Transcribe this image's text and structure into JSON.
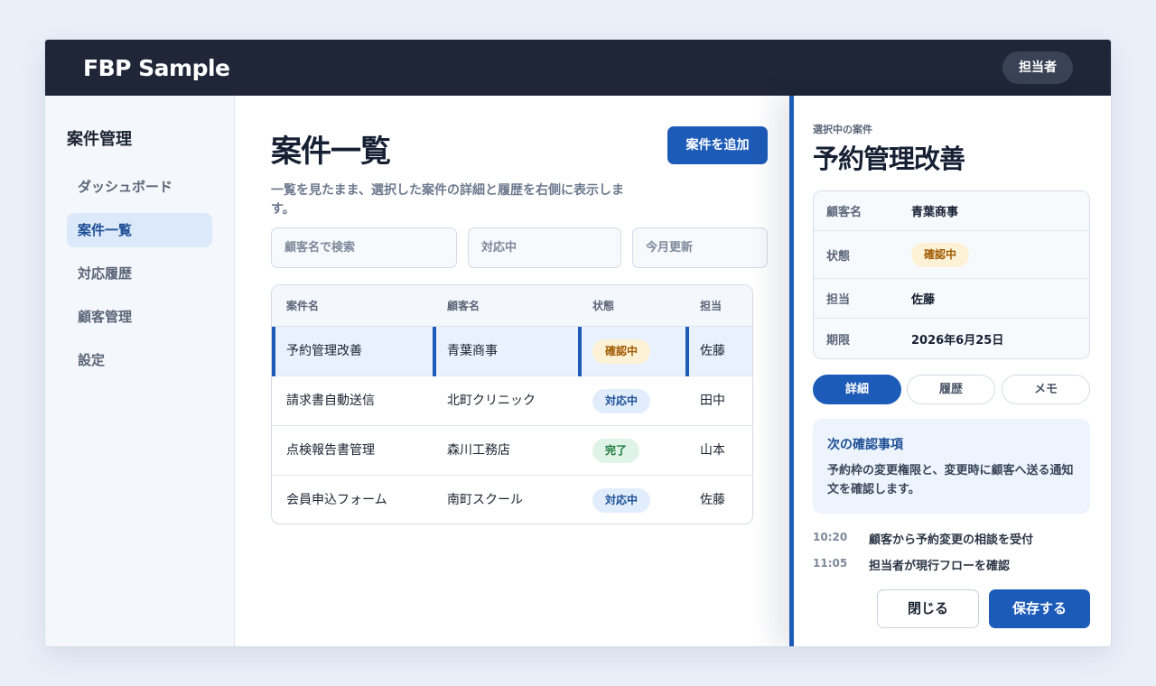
{
  "app": {
    "brand": "FBP Sample",
    "user": "担当者"
  },
  "sidebar": {
    "title": "案件管理",
    "items": [
      {
        "label": "ダッシュボード",
        "active": false
      },
      {
        "label": "案件一覧",
        "active": true
      },
      {
        "label": "対応履歴",
        "active": false
      },
      {
        "label": "顧客管理",
        "active": false
      },
      {
        "label": "設定",
        "active": false
      }
    ]
  },
  "main": {
    "title": "案件一覧",
    "description": "一覧を見たまま、選択した案件の詳細と履歴を右側に表示します。",
    "add_button": "案件を追加",
    "filters": {
      "search_placeholder": "顧客名で検索",
      "status_value": "対応中",
      "period_value": "今月更新"
    },
    "table": {
      "headers": [
        "案件名",
        "顧客名",
        "状態",
        "担当"
      ],
      "rows": [
        {
          "name": "予約管理改善",
          "customer": "青葉商事",
          "status": "確認中",
          "status_type": "warn",
          "owner": "佐藤",
          "selected": true
        },
        {
          "name": "請求書自動送信",
          "customer": "北町クリニック",
          "status": "対応中",
          "status_type": "prog",
          "owner": "田中",
          "selected": false
        },
        {
          "name": "点検報告書管理",
          "customer": "森川工務店",
          "status": "完了",
          "status_type": "done",
          "owner": "山本",
          "selected": false
        },
        {
          "name": "会員申込フォーム",
          "customer": "南町スクール",
          "status": "対応中",
          "status_type": "prog",
          "owner": "佐藤",
          "selected": false
        }
      ]
    }
  },
  "panel": {
    "kicker": "選択中の案件",
    "title": "予約管理改善",
    "info": {
      "customer_label": "顧客名",
      "customer_value": "青葉商事",
      "status_label": "状態",
      "status_value": "確認中",
      "owner_label": "担当",
      "owner_value": "佐藤",
      "due_label": "期限",
      "due_value": "2026年6月25日"
    },
    "tabs": [
      "詳細",
      "履歴",
      "メモ"
    ],
    "active_tab": "詳細",
    "note": {
      "title": "次の確認事項",
      "body": "予約枠の変更権限と、変更時に顧客へ送る通知文を確認します。"
    },
    "history": [
      {
        "time": "10:20",
        "text": "顧客から予約変更の相談を受付"
      },
      {
        "time": "11:05",
        "text": "担当者が現行フローを確認"
      }
    ],
    "close_button": "閉じる",
    "save_button": "保存する"
  },
  "colors": {
    "accent": "#1d5bb8",
    "topbar": "#1e2637",
    "warn": "#a05a00",
    "done": "#1b7a3c"
  }
}
